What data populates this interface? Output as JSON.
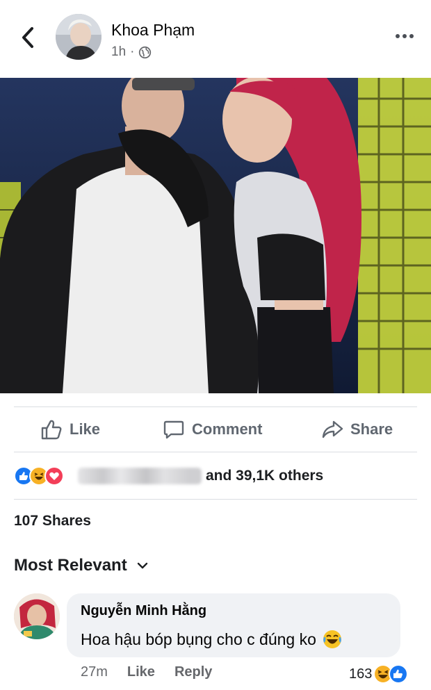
{
  "post": {
    "author": "Khoa Phạm",
    "time": "1h",
    "separator": "·",
    "privacy_icon": "globe-icon"
  },
  "actions": {
    "like": "Like",
    "comment": "Comment",
    "share": "Share"
  },
  "reactions": {
    "types": [
      "like",
      "haha",
      "love"
    ],
    "others_text": "and 39,1K others"
  },
  "shares_text": "107 Shares",
  "sort_label": "Most Relevant",
  "comment": {
    "author": "Nguyễn Minh Hằng",
    "text": "Hoa hậu bóp bụng cho c đúng ko",
    "time": "27m",
    "like": "Like",
    "reply": "Reply",
    "reaction_count": "163"
  },
  "colors": {
    "like_blue": "#1877f2",
    "love_red": "#f33e58",
    "haha_yellow": "#f7b125",
    "muted": "#65676b"
  }
}
